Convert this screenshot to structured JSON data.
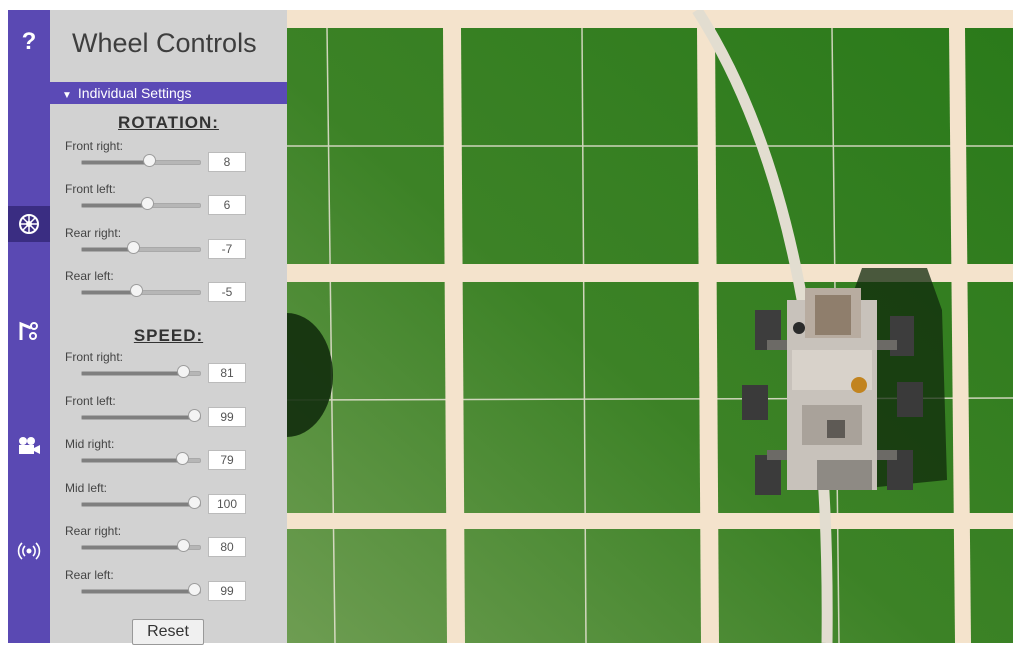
{
  "rail": {
    "help_glyph": "?",
    "icons": [
      "help-icon",
      "wheel-icon",
      "robot-arm-icon",
      "camera-icon",
      "signal-icon"
    ]
  },
  "panel": {
    "title": "Wheel Controls",
    "section": "Individual Settings",
    "rotation_heading": "ROTATION:",
    "speed_heading": "SPEED:",
    "rotation": [
      {
        "label": "Front right:",
        "value": "8"
      },
      {
        "label": "Front left:",
        "value": "6"
      },
      {
        "label": "Rear right:",
        "value": "-7"
      },
      {
        "label": "Rear left:",
        "value": "-5"
      }
    ],
    "speed": [
      {
        "label": "Front right:",
        "value": "81"
      },
      {
        "label": "Front left:",
        "value": "99"
      },
      {
        "label": "Mid right:",
        "value": "79"
      },
      {
        "label": "Mid left:",
        "value": "100"
      },
      {
        "label": "Rear right:",
        "value": "80"
      },
      {
        "label": "Rear left:",
        "value": "99"
      }
    ],
    "reset_label": "Reset"
  },
  "sliders": {
    "rotation_fraction": [
      0.57,
      0.55,
      0.43,
      0.46
    ],
    "speed_fraction": [
      0.85,
      0.94,
      0.84,
      0.94,
      0.85,
      0.94
    ]
  },
  "colors": {
    "accent": "#5a49b3",
    "ground": "#2f7a1e",
    "grid_line": "#f2e2cc"
  }
}
